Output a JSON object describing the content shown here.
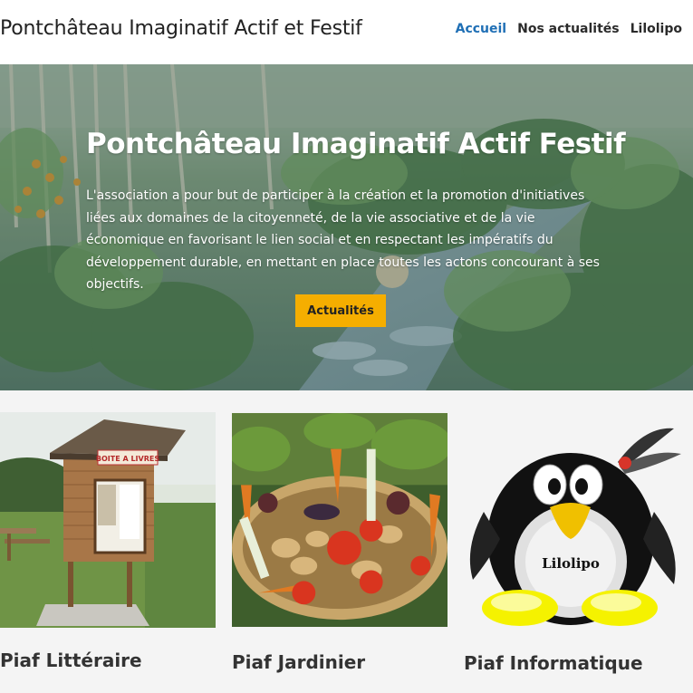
{
  "header": {
    "site_title": "Pontchâteau Imaginatif Actif et Festif",
    "nav": [
      {
        "label": "Accueil",
        "active": true
      },
      {
        "label": "Nos actualités",
        "active": false
      },
      {
        "label": "Lilolipo",
        "active": false
      }
    ]
  },
  "hero": {
    "title": "Pontchâteau Imaginatif Actif Festif",
    "text": "L'association a pour but de participer à la création et la promotion d'initiatives liées aux domaines de la citoyenneté, de la vie associative et de la vie économique en favorisant le lien social et en respectant les impératifs du développement durable, en mettant en place toutes les actons concourant à ses objectifs.",
    "button_label": "Actualités"
  },
  "cards": [
    {
      "title": "Piaf Littéraire",
      "image": "book-box-photo",
      "sign_text": "BOITE A LIVRES"
    },
    {
      "title": "Piaf Jardinier",
      "image": "vegetable-basket-photo"
    },
    {
      "title": "Piaf Informatique",
      "image": "penguin-logo",
      "logo_text": "Lilolipo"
    }
  ],
  "colors": {
    "accent": "#1f6fb5",
    "button": "#f5ae00",
    "cards_background": "#f4f4f4"
  }
}
